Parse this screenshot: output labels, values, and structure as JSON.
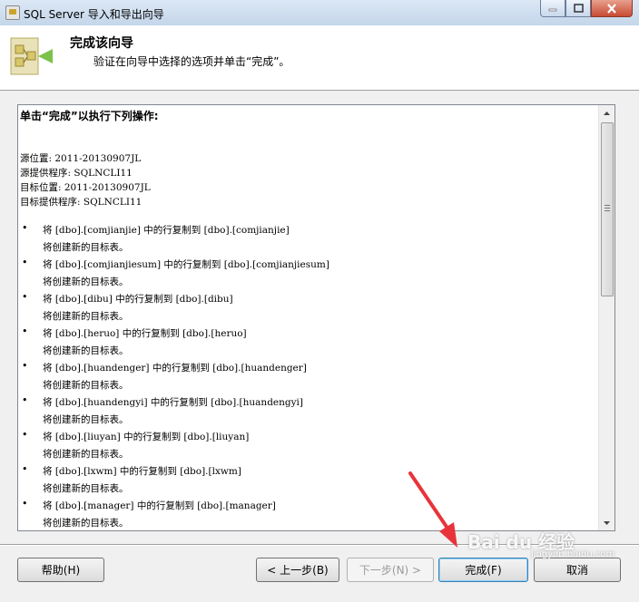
{
  "window": {
    "title": "SQL Server 导入和导出向导"
  },
  "header": {
    "title": "完成该向导",
    "description": "验证在向导中选择的选项并单击“完成”。"
  },
  "summary": {
    "heading": "单击“完成”以执行下列操作:",
    "info": [
      "源位置: 2011-20130907JL",
      "源提供程序: SQLNCLI11",
      "目标位置: 2011-20130907JL",
      "目标提供程序: SQLNCLI11"
    ],
    "bullet": "•",
    "operations": [
      {
        "action": "将 [dbo].[comjianjie] 中的行复制到 [dbo].[comjianjie]",
        "note": "将创建新的目标表。"
      },
      {
        "action": "将 [dbo].[comjianjiesum] 中的行复制到 [dbo].[comjianjiesum]",
        "note": "将创建新的目标表。"
      },
      {
        "action": "将 [dbo].[dibu] 中的行复制到 [dbo].[dibu]",
        "note": "将创建新的目标表。"
      },
      {
        "action": "将 [dbo].[heruo] 中的行复制到 [dbo].[heruo]",
        "note": "将创建新的目标表。"
      },
      {
        "action": "将 [dbo].[huandenger] 中的行复制到 [dbo].[huandenger]",
        "note": "将创建新的目标表。"
      },
      {
        "action": "将 [dbo].[huandengyi] 中的行复制到 [dbo].[huandengyi]",
        "note": "将创建新的目标表。"
      },
      {
        "action": "将 [dbo].[liuyan] 中的行复制到 [dbo].[liuyan]",
        "note": "将创建新的目标表。"
      },
      {
        "action": "将 [dbo].[lxwm] 中的行复制到 [dbo].[lxwm]",
        "note": "将创建新的目标表。"
      },
      {
        "action": "将 [dbo].[manager] 中的行复制到 [dbo].[manager]",
        "note": "将创建新的目标表。"
      }
    ]
  },
  "buttons": {
    "help": "帮助(H)",
    "back": "< 上一步(B)",
    "next": "下一步(N) >",
    "finish": "完成(F)",
    "cancel": "取消"
  },
  "watermark": {
    "brand": "Bai du 经验",
    "site": "jingyan.baidu.com"
  },
  "colors": {
    "arrow": "#e8333a",
    "accent": "#3c7fb1"
  }
}
